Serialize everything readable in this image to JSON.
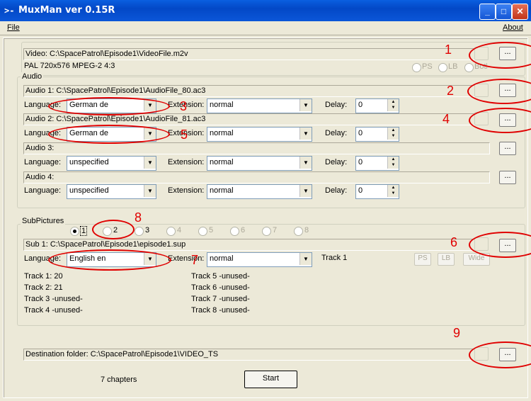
{
  "window": {
    "title": "MuxMan ver 0.15R",
    "icon": "app-icon",
    "icon_glyph": ">-"
  },
  "menu": {
    "file": "File",
    "about": "About"
  },
  "video": {
    "path": "Video: C:\\SpacePatrol\\Episode1\\VideoFile.m2v",
    "info": "PAL  720x576  MPEG-2  4:3",
    "radios": [
      "PS",
      "LB",
      "Both"
    ]
  },
  "audio": {
    "group_label": "Audio",
    "language_label": "Language:",
    "extension_label": "Extension:",
    "delay_label": "Delay:",
    "tracks": [
      {
        "path": "Audio 1: C:\\SpacePatrol\\Episode1\\AudioFile_80.ac3",
        "language": "German de",
        "extension": "normal",
        "delay": "0"
      },
      {
        "path": "Audio 2: C:\\SpacePatrol\\Episode1\\AudioFile_81.ac3",
        "language": "German de",
        "extension": "normal",
        "delay": "0"
      },
      {
        "path": "Audio 3:",
        "language": "unspecified",
        "extension": "normal",
        "delay": "0"
      },
      {
        "path": "Audio 4:",
        "language": "unspecified",
        "extension": "normal",
        "delay": "0"
      }
    ]
  },
  "subpictures": {
    "group_label": "SubPictures",
    "tabs": [
      "1",
      "2",
      "3",
      "4",
      "5",
      "6",
      "7",
      "8"
    ],
    "selected_tab": "1",
    "path": "Sub 1: C:\\SpacePatrol\\Episode1\\episode1.sup",
    "language_label": "Language:",
    "language": "English en",
    "extension_label": "Extension:",
    "extension": "normal",
    "track_label": "Track 1",
    "buttons": {
      "ps": "PS",
      "lb": "LB",
      "wide": "Wide"
    },
    "tracks_left": [
      "Track 1:  20",
      "Track 2:  21",
      "Track 3  -unused-",
      "Track 4  -unused-"
    ],
    "tracks_right": [
      "Track 5  -unused-",
      "Track 6  -unused-",
      "Track 7  -unused-",
      "Track 8  -unused-"
    ]
  },
  "destination": {
    "path": "Destination folder: C:\\SpacePatrol\\Episode1\\VIDEO_TS"
  },
  "chapters": "7 chapters",
  "start_label": "Start",
  "browse_label": "...",
  "annotations": [
    "1",
    "2",
    "3",
    "4",
    "5",
    "6",
    "7",
    "8",
    "9"
  ],
  "colors": {
    "titlebar": "#0348c6",
    "annotation": "#e00000",
    "window_bg": "#ece9d8"
  }
}
